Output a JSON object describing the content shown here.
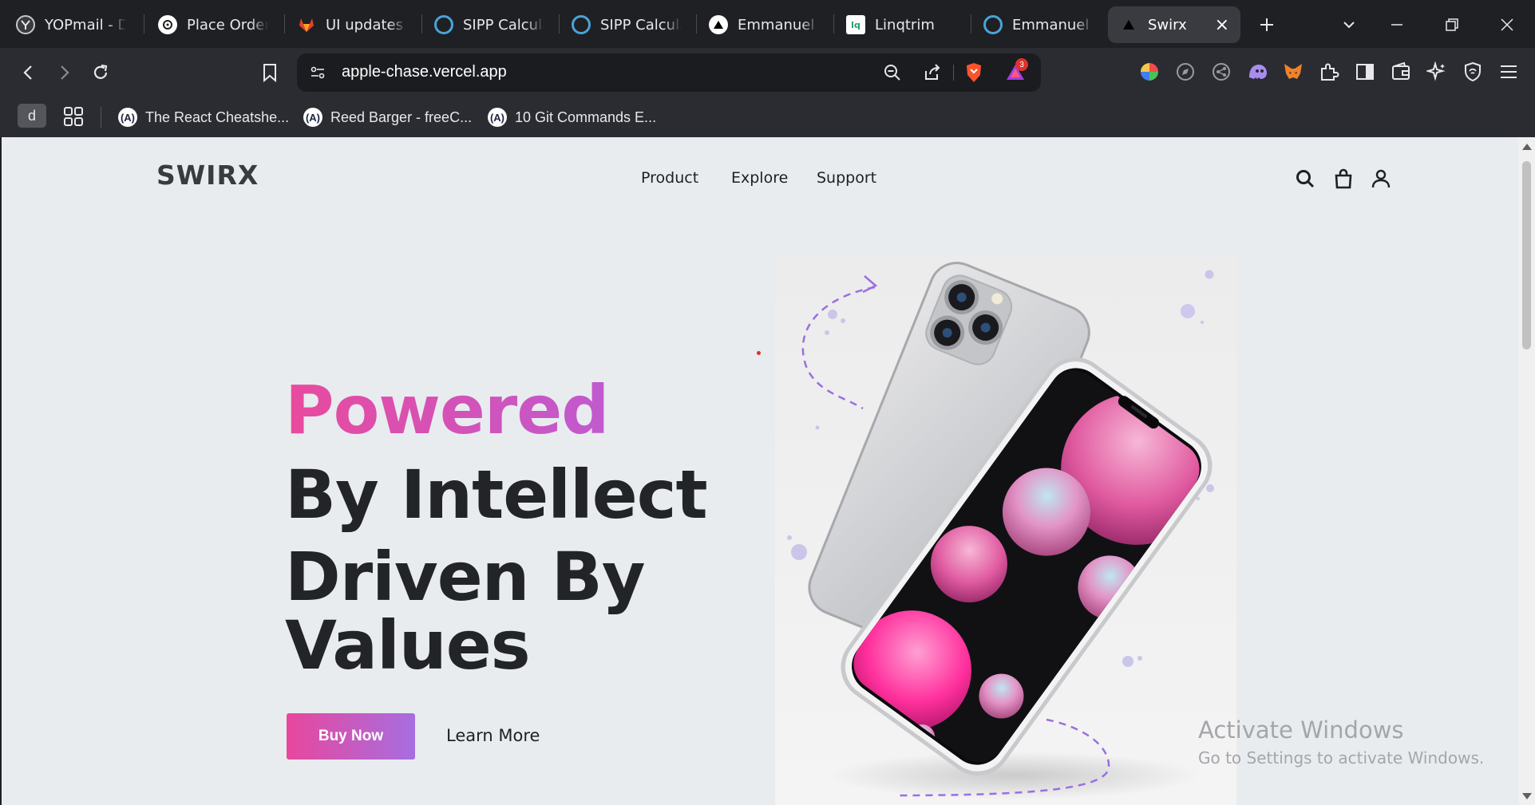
{
  "browser": {
    "tabs": [
      {
        "title": "YOPmail - Disposable",
        "favicon": "yopmail-icon",
        "active": false
      },
      {
        "title": "Place Order",
        "favicon": "openai-icon",
        "active": false
      },
      {
        "title": "UI updates (",
        "favicon": "gitlab-icon",
        "active": false
      },
      {
        "title": "SIPP Calculator",
        "favicon": "circle-icon",
        "active": false
      },
      {
        "title": "SIPP Calculator",
        "favicon": "circle-icon",
        "active": false
      },
      {
        "title": "Emmanuel |",
        "favicon": "vercel-icon",
        "active": false
      },
      {
        "title": "Linqtrim",
        "favicon": "linqtrim-icon",
        "active": false
      },
      {
        "title": "Emmanuel |",
        "favicon": "circle-icon",
        "active": false
      },
      {
        "title": "Swirx",
        "favicon": "vercel-icon",
        "active": true
      }
    ],
    "address": "apple-chase.vercel.app",
    "brave_rewards_count": "3",
    "bookmarks": {
      "profile_initial": "d",
      "items": [
        {
          "label": "The React Cheatshe...",
          "favicon_text": "(A)"
        },
        {
          "label": "Reed Barger - freeC...",
          "favicon_text": "(A)"
        },
        {
          "label": "10 Git Commands E...",
          "favicon_text": "(A)"
        }
      ]
    }
  },
  "page": {
    "logo": "SWIRX",
    "nav": [
      "Product",
      "Explore",
      "Support"
    ],
    "hero": {
      "highlight": "Powered",
      "lines": [
        "By Intellect",
        "Driven By",
        "Values"
      ]
    },
    "buy_button": "Buy Now",
    "learn_more": "Learn More"
  },
  "windows_watermark": {
    "title": "Activate Windows",
    "subtitle": "Go to Settings to activate Windows."
  },
  "colors": {
    "accent_pink": "#e94a9d",
    "accent_purple": "#a76ee0",
    "page_bg": "#e8ecef",
    "chrome_bg": "#1f2024"
  }
}
